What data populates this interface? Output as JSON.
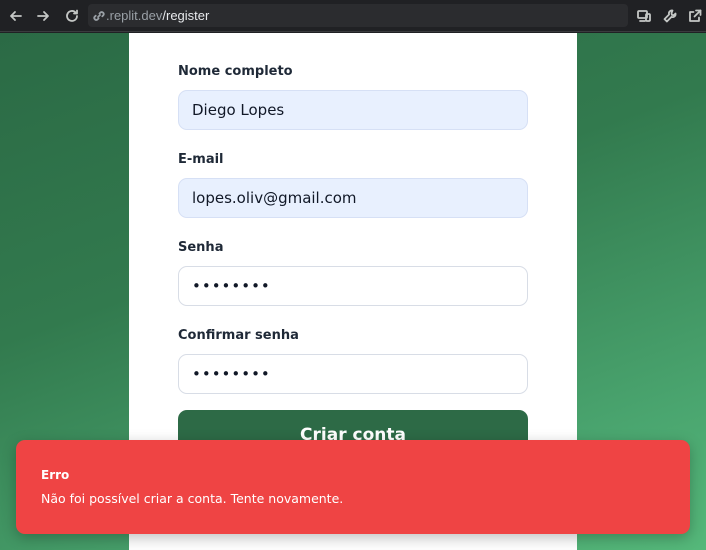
{
  "browser": {
    "url_domain": ".replit.dev",
    "url_path": "/register",
    "icons": [
      "back-icon",
      "forward-icon",
      "reload-icon",
      "link-icon",
      "devices-icon",
      "wrench-icon",
      "open-external-icon"
    ]
  },
  "form": {
    "name_label": "Nome completo",
    "name_value": "Diego Lopes",
    "email_label": "E-mail",
    "email_value": "lopes.oliv@gmail.com",
    "password_label": "Senha",
    "password_value": "••••••••",
    "confirm_label": "Confirmar senha",
    "confirm_value": "••••••••",
    "submit_label": "Criar conta"
  },
  "toast": {
    "title": "Erro",
    "message": "Não foi possível criar a conta. Tente novamente."
  },
  "colors": {
    "background_green": "#327a4e",
    "button_green": "#2d6a46",
    "toast_red": "#ef4444",
    "input_autofill": "#e8f0fe"
  }
}
